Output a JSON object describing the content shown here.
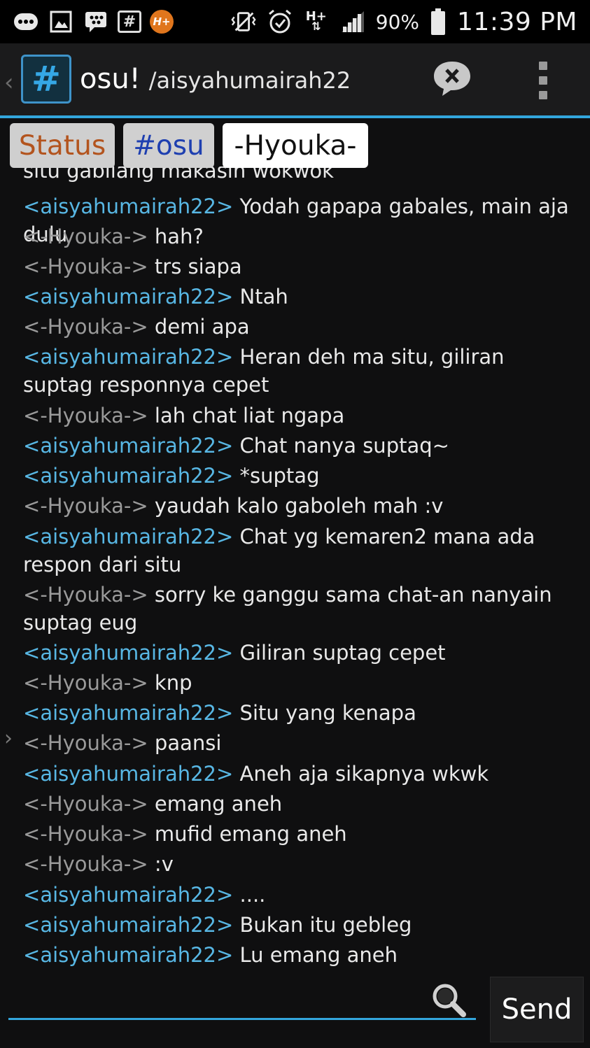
{
  "status_bar": {
    "icons": [
      "bbm-icon",
      "gallery-icon",
      "blackberry-icon",
      "hash-icon",
      "h-plus-notification-icon",
      "vibrate-icon",
      "alarm-icon",
      "h-plus-network-icon",
      "signal-icon",
      "battery-icon"
    ],
    "hash_label": "#",
    "hplus_label": "H+",
    "network_label": "H+",
    "battery_pct": "90%",
    "time": "11:39 PM"
  },
  "titlebar": {
    "app_icon_label": "#",
    "title": "osu!",
    "subtitle": "/aisyahumairah22"
  },
  "tabs": [
    {
      "label": "Status"
    },
    {
      "label": "#osu"
    },
    {
      "label": "-Hyouka-"
    }
  ],
  "colors": {
    "accent": "#33a6dc",
    "nick_self": "#58b7e4",
    "nick_other": "#9a9a9a",
    "background": "#0f0f10"
  },
  "chat": {
    "partial_line": "situ gabilang makasih wokwok",
    "messages": [
      {
        "nick": "aisyahumairah22",
        "text": "Yodah gapapa gabales, main aja dulu",
        "self": true
      },
      {
        "nick": "-Hyouka-",
        "text": "hah?",
        "self": false
      },
      {
        "nick": "-Hyouka-",
        "text": "trs siapa",
        "self": false
      },
      {
        "nick": "aisyahumairah22",
        "text": "Ntah",
        "self": true
      },
      {
        "nick": "-Hyouka-",
        "text": "demi apa",
        "self": false
      },
      {
        "nick": "aisyahumairah22",
        "text": "Heran deh ma situ, giliran suptag responnya cepet",
        "self": true
      },
      {
        "nick": "-Hyouka-",
        "text": "lah chat liat ngapa",
        "self": false
      },
      {
        "nick": "aisyahumairah22",
        "text": "Chat nanya suptaq~",
        "self": true
      },
      {
        "nick": "aisyahumairah22",
        "text": "*suptag",
        "self": true
      },
      {
        "nick": "-Hyouka-",
        "text": "yaudah kalo gaboleh mah :v",
        "self": false
      },
      {
        "nick": "aisyahumairah22",
        "text": "Chat yg kemaren2 mana ada respon dari situ",
        "self": true
      },
      {
        "nick": "-Hyouka-",
        "text": "sorry ke ganggu sama chat-an nanyain suptag eug",
        "self": false
      },
      {
        "nick": "aisyahumairah22",
        "text": "Giliran suptag cepet",
        "self": true
      },
      {
        "nick": "-Hyouka-",
        "text": "knp",
        "self": false
      },
      {
        "nick": "aisyahumairah22",
        "text": "Situ yang kenapa",
        "self": true
      },
      {
        "nick": "-Hyouka-",
        "text": "paansi",
        "self": false
      },
      {
        "nick": "aisyahumairah22",
        "text": "Aneh aja sikapnya wkwk",
        "self": true
      },
      {
        "nick": "-Hyouka-",
        "text": "emang aneh",
        "self": false
      },
      {
        "nick": "-Hyouka-",
        "text": "mufid emang aneh",
        "self": false
      },
      {
        "nick": "-Hyouka-",
        "text": ":v",
        "self": false
      },
      {
        "nick": "aisyahumairah22",
        "text": "....",
        "self": true
      },
      {
        "nick": "aisyahumairah22",
        "text": "Bukan itu gebleg",
        "self": true
      },
      {
        "nick": "aisyahumairah22",
        "text": "Lu emang aneh",
        "self": true
      }
    ]
  },
  "input": {
    "value": "",
    "placeholder": "",
    "send_label": "Send"
  }
}
